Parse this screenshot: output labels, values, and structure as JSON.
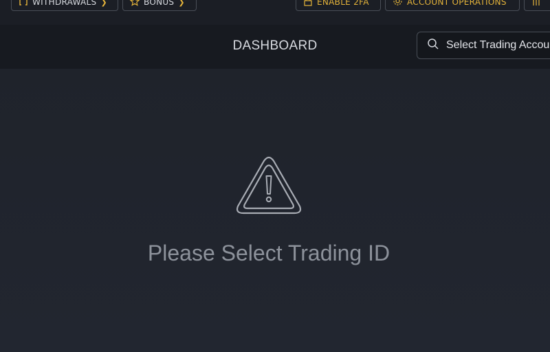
{
  "top_nav": {
    "withdrawals_label": "WITHDRAWALS",
    "bonus_label": "BONUS",
    "enable_2fa_label": "ENABLE 2FA",
    "account_operations_label": "ACCOUNT OPERATIONS"
  },
  "header": {
    "title": "DASHBOARD",
    "search_placeholder": "Select Trading Account"
  },
  "empty_state": {
    "message": "Please Select Trading ID"
  },
  "colors": {
    "accent_gold": "#e5b43a",
    "background": "#1f232b",
    "header_bg": "#171a20"
  }
}
